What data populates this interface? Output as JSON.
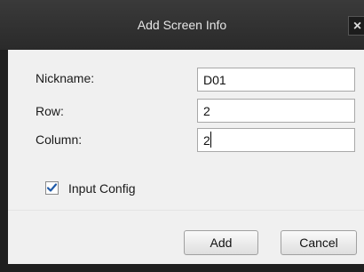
{
  "dialog": {
    "title": "Add Screen Info",
    "close_glyph": "×",
    "close_icon": "close-icon"
  },
  "form": {
    "nickname_label": "Nickname:",
    "nickname_value": "D01",
    "row_label": "Row:",
    "row_value": "2",
    "column_label": "Column:",
    "column_value": "2"
  },
  "input_config": {
    "label": "Input Config",
    "checked": true,
    "icon": "checkmark-icon"
  },
  "buttons": {
    "add_label": "Add",
    "cancel_label": "Cancel"
  },
  "colors": {
    "titlebar": "#2f2f2f",
    "dialog_background": "#f0f0f0",
    "checkmark": "#1f5aa8"
  }
}
